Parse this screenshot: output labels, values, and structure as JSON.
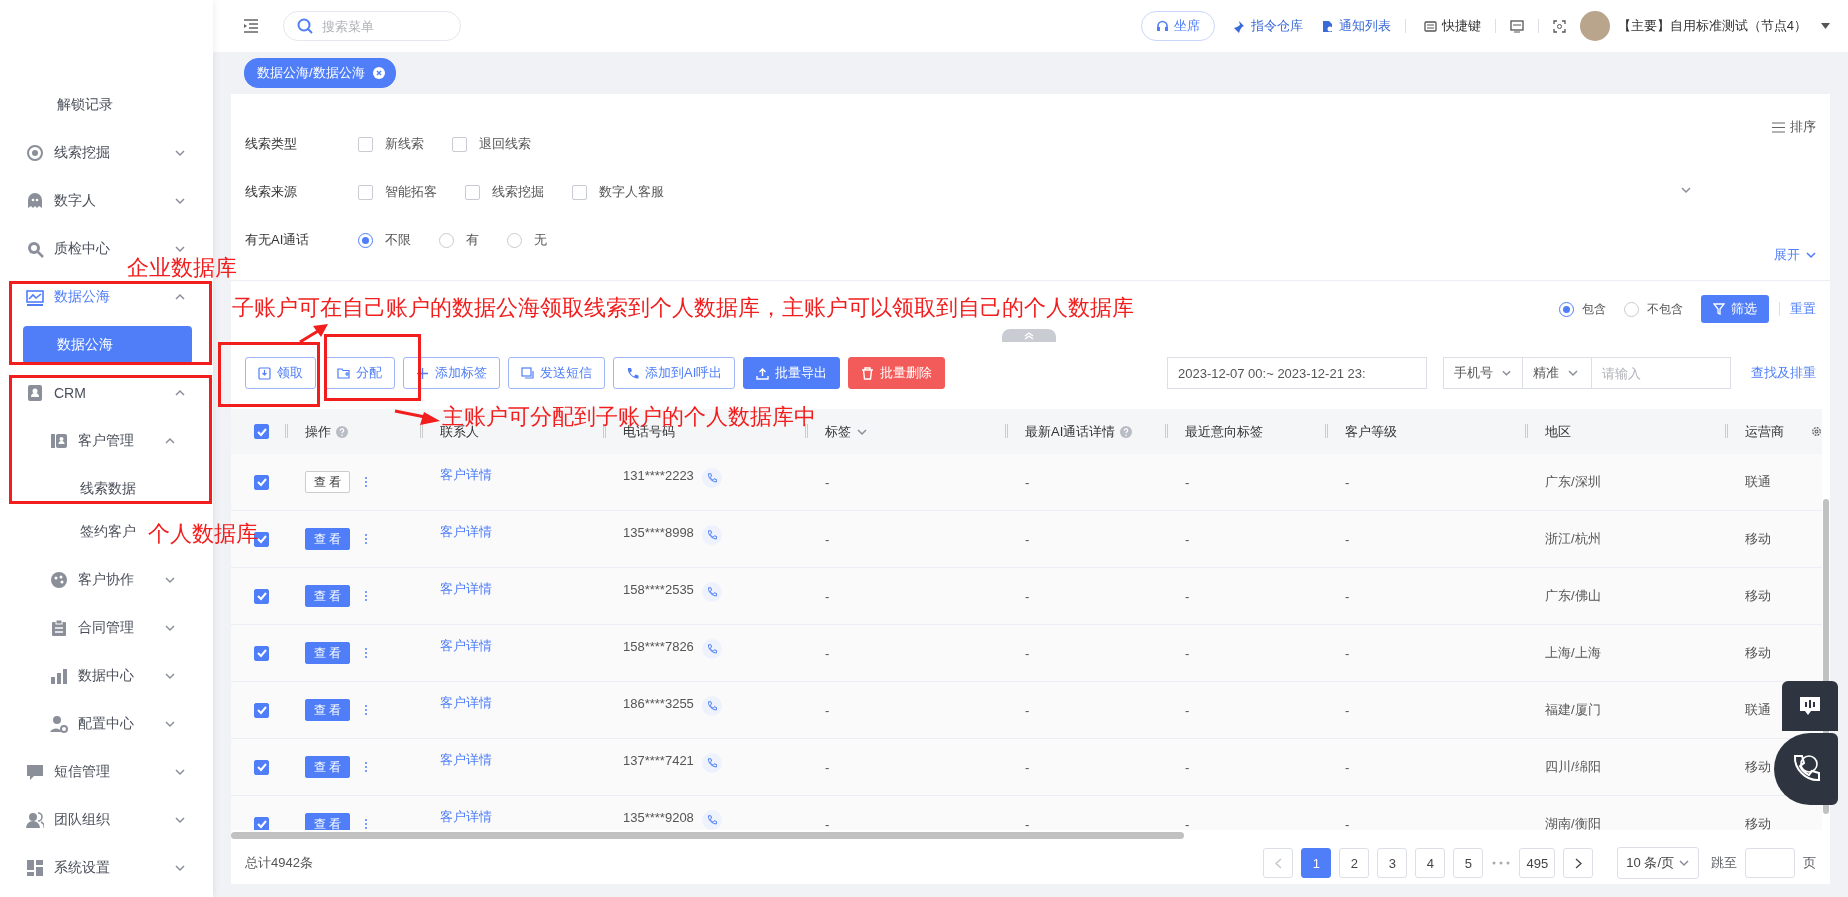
{
  "sidebar": {
    "items": [
      {
        "label": "解锁记录",
        "kind": "leaf",
        "selected": false
      },
      {
        "label": "线索挖掘",
        "kind": "group",
        "expanded": false,
        "selected": false
      },
      {
        "label": "数字人",
        "kind": "group",
        "expanded": false,
        "selected": false
      },
      {
        "label": "质检中心",
        "kind": "group",
        "expanded": false,
        "selected": false
      },
      {
        "label": "数据公海",
        "kind": "group",
        "expanded": true,
        "selected": true,
        "children": [
          {
            "label": "数据公海",
            "kind": "leaf",
            "selected": true
          }
        ]
      },
      {
        "label": "CRM",
        "kind": "group",
        "expanded": true,
        "selected": false,
        "children": [
          {
            "label": "客户管理",
            "kind": "group",
            "expanded": true,
            "selected": false,
            "children": [
              {
                "label": "线索数据",
                "kind": "leaf",
                "selected": false
              },
              {
                "label": "签约客户",
                "kind": "leaf",
                "selected": false
              }
            ]
          },
          {
            "label": "客户协作",
            "kind": "group",
            "expanded": false,
            "selected": false
          },
          {
            "label": "合同管理",
            "kind": "group",
            "expanded": false,
            "selected": false
          },
          {
            "label": "数据中心",
            "kind": "group",
            "expanded": false,
            "selected": false
          },
          {
            "label": "配置中心",
            "kind": "group",
            "expanded": false,
            "selected": false
          }
        ]
      },
      {
        "label": "短信管理",
        "kind": "group",
        "expanded": false,
        "selected": false
      },
      {
        "label": "团队组织",
        "kind": "group",
        "expanded": false,
        "selected": false
      },
      {
        "label": "系统设置",
        "kind": "group",
        "expanded": false,
        "selected": false
      }
    ]
  },
  "topbar": {
    "search_placeholder": "搜索菜单",
    "seat": "坐席",
    "links": [
      "指令仓库",
      "通知列表",
      "快捷键"
    ],
    "user": "【主要】自用标准测试（节点4）"
  },
  "tabs": [
    {
      "label": "数据公海/数据公海",
      "selected": true
    }
  ],
  "filters": {
    "groups": [
      {
        "label": "线索类型",
        "kind": "checkbox",
        "options": [
          {
            "label": "新线索",
            "checked": false
          },
          {
            "label": "退回线索",
            "checked": false
          }
        ]
      },
      {
        "label": "线索来源",
        "kind": "checkbox",
        "options": [
          {
            "label": "智能拓客",
            "checked": false
          },
          {
            "label": "线索挖掘",
            "checked": false
          },
          {
            "label": "数字人客服",
            "checked": false
          }
        ]
      },
      {
        "label": "有无AI通话",
        "kind": "radio",
        "options": [
          {
            "label": "不限",
            "selected": true
          },
          {
            "label": "有",
            "selected": false
          },
          {
            "label": "无",
            "selected": false
          }
        ]
      }
    ],
    "sort": "排序",
    "expand": "展开",
    "match": [
      {
        "label": "包含",
        "selected": true
      },
      {
        "label": "不包含",
        "selected": false
      }
    ],
    "filter_button": "筛选",
    "reset": "重置"
  },
  "toolbar": {
    "actions": [
      {
        "label": "领取",
        "kind": "outline"
      },
      {
        "label": "分配",
        "kind": "outline"
      },
      {
        "label": "添加标签",
        "kind": "outline"
      },
      {
        "label": "发送短信",
        "kind": "outline"
      },
      {
        "label": "添加到AI呼出",
        "kind": "outline"
      },
      {
        "label": "批量导出",
        "kind": "primary"
      },
      {
        "label": "批量删除",
        "kind": "danger"
      }
    ],
    "date_range": "2023-12-07 00:~ 2023-12-21 23:",
    "field_select": "手机号",
    "mode_select": "精准",
    "placeholder": "请输入",
    "link": "查找及排重"
  },
  "table": {
    "all_checked": true,
    "columns": [
      {
        "label": "操作",
        "help": true,
        "sortable": false
      },
      {
        "label": "联系人",
        "help": false,
        "sortable": false
      },
      {
        "label": "电话号码",
        "help": false,
        "sortable": false
      },
      {
        "label": "标签",
        "help": false,
        "sortable": true
      },
      {
        "label": "最新AI通话详情",
        "help": true,
        "sortable": false
      },
      {
        "label": "最近意向标签",
        "help": false,
        "sortable": false
      },
      {
        "label": "客户等级",
        "help": false,
        "sortable": false
      },
      {
        "label": "地区",
        "help": false,
        "sortable": false
      },
      {
        "label": "运营商",
        "help": false,
        "sortable": false
      }
    ],
    "rows": [
      {
        "checked": true,
        "action": "查 看",
        "hovered": true,
        "contact": "客户详情",
        "phone": "131****2223",
        "tag": "-",
        "ai_call": "-",
        "intent": "-",
        "grade": "-",
        "region": "广东/深圳",
        "carrier": "联通"
      },
      {
        "checked": true,
        "action": "查 看",
        "hovered": false,
        "contact": "客户详情",
        "phone": "135****8998",
        "tag": "-",
        "ai_call": "-",
        "intent": "-",
        "grade": "-",
        "region": "浙江/杭州",
        "carrier": "移动"
      },
      {
        "checked": true,
        "action": "查 看",
        "hovered": false,
        "contact": "客户详情",
        "phone": "158****2535",
        "tag": "-",
        "ai_call": "-",
        "intent": "-",
        "grade": "-",
        "region": "广东/佛山",
        "carrier": "移动"
      },
      {
        "checked": true,
        "action": "查 看",
        "hovered": false,
        "contact": "客户详情",
        "phone": "158****7826",
        "tag": "-",
        "ai_call": "-",
        "intent": "-",
        "grade": "-",
        "region": "上海/上海",
        "carrier": "移动"
      },
      {
        "checked": true,
        "action": "查 看",
        "hovered": false,
        "contact": "客户详情",
        "phone": "186****3255",
        "tag": "-",
        "ai_call": "-",
        "intent": "-",
        "grade": "-",
        "region": "福建/厦门",
        "carrier": "联通"
      },
      {
        "checked": true,
        "action": "查 看",
        "hovered": false,
        "contact": "客户详情",
        "phone": "137****7421",
        "tag": "-",
        "ai_call": "-",
        "intent": "-",
        "grade": "-",
        "region": "四川/绵阳",
        "carrier": "移动"
      },
      {
        "checked": true,
        "action": "查 看",
        "hovered": false,
        "contact": "客户详情",
        "phone": "135****9208",
        "tag": "-",
        "ai_call": "-",
        "intent": "-",
        "grade": "-",
        "region": "湖南/衡阳",
        "carrier": "移动"
      }
    ]
  },
  "pagination": {
    "total": "总计4942条",
    "pages": [
      {
        "label": "1",
        "selected": true
      },
      {
        "label": "2",
        "selected": false
      },
      {
        "label": "3",
        "selected": false
      },
      {
        "label": "4",
        "selected": false
      },
      {
        "label": "5",
        "selected": false
      }
    ],
    "last_page": {
      "label": "495",
      "selected": false
    },
    "page_size": "10 条/页",
    "jump_label": "跳至",
    "page_unit": "页"
  },
  "annotations": [
    {
      "kind": "label",
      "text": "企业数据库"
    },
    {
      "kind": "label",
      "text": "个人数据库"
    },
    {
      "kind": "label",
      "text": "子账户可在自己账户的数据公海领取线索到个人数据库，主账户可以领取到自己的个人数据库"
    },
    {
      "kind": "label",
      "text": "主账户可分配到子账户的个人数据库中"
    }
  ]
}
